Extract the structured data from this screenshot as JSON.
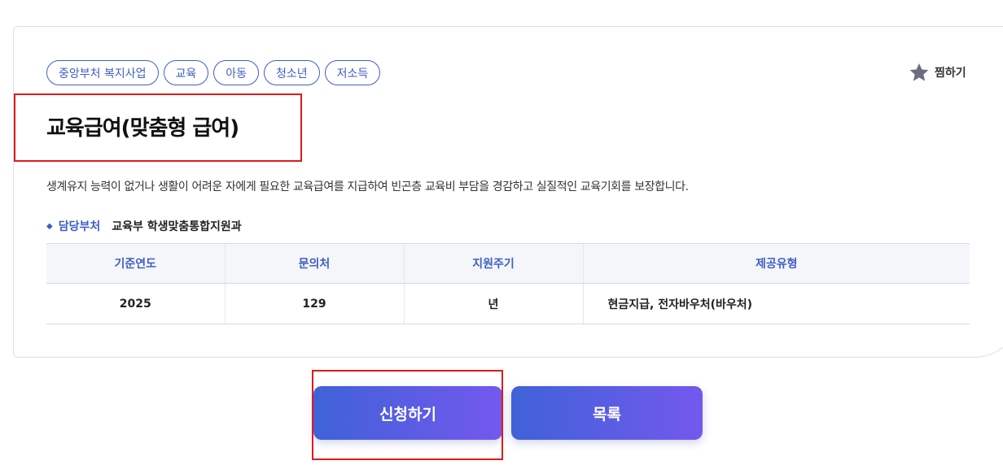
{
  "tags": [
    "중앙부처 복지사업",
    "교육",
    "아동",
    "청소년",
    "저소득"
  ],
  "favorite_label": "찜하기",
  "title": "교육급여(맞춤형 급여)",
  "description": "생계유지 능력이 없거나 생활이 어려운 자에게 필요한 교육급여를 지급하여 빈곤층 교육비 부담을 경감하고 실질적인 교육기회를 보장합니다.",
  "department": {
    "bullet": "◆",
    "label": "담당부처",
    "value": "교육부 학생맞춤통합지원과"
  },
  "table": {
    "headers": [
      "기준연도",
      "문의처",
      "지원주기",
      "제공유형"
    ],
    "row": [
      "2025",
      "129",
      "년",
      "현금지급, 전자바우처(바우처)"
    ]
  },
  "buttons": {
    "apply": "신청하기",
    "list": "목록"
  },
  "colors": {
    "accent": "#3e5fc2",
    "highlight": "#e01a1a",
    "gradient_start": "#3f62d8",
    "gradient_end": "#7458ee"
  },
  "icons": {
    "favorite": "star-icon"
  }
}
